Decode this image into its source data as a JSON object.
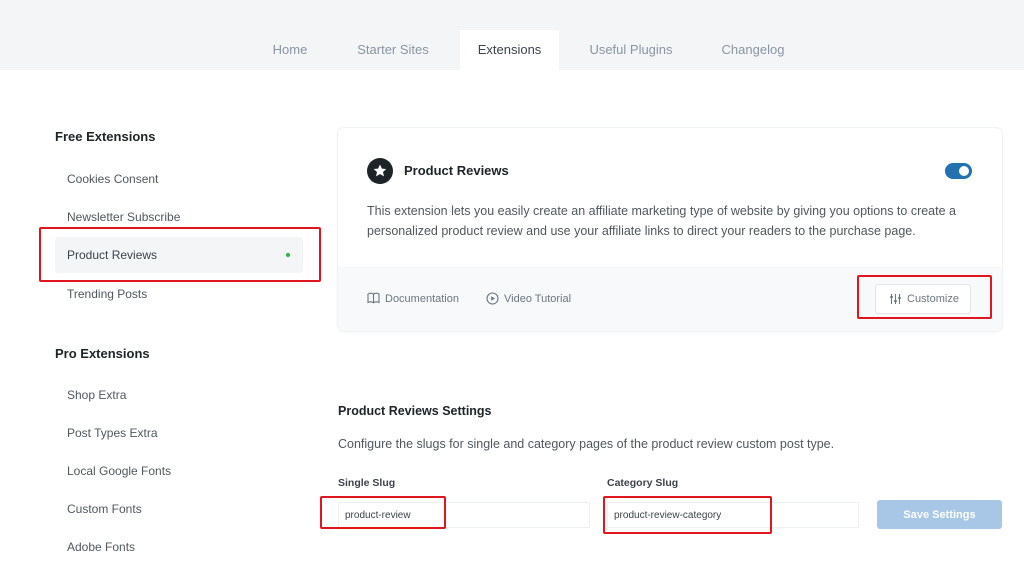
{
  "tabs": [
    {
      "label": "Home",
      "active": false
    },
    {
      "label": "Starter Sites",
      "active": false
    },
    {
      "label": "Extensions",
      "active": true
    },
    {
      "label": "Useful Plugins",
      "active": false
    },
    {
      "label": "Changelog",
      "active": false
    }
  ],
  "sidebar": {
    "free_heading": "Free Extensions",
    "free_items": [
      "Cookies Consent",
      "Newsletter Subscribe",
      "Product Reviews",
      "Trending Posts"
    ],
    "pro_heading": "Pro Extensions",
    "pro_items": [
      "Shop Extra",
      "Post Types Extra",
      "Local Google Fonts",
      "Custom Fonts",
      "Adobe Fonts"
    ],
    "active_item": "Product Reviews"
  },
  "card": {
    "icon": "star-icon",
    "title": "Product Reviews",
    "enabled": true,
    "description": "This extension lets you easily create an affiliate marketing type of website by giving you options to create a personalized product review and use your affiliate links to direct your readers to the purchase page.",
    "documentation_label": "Documentation",
    "documentation_icon": "book-icon",
    "video_label": "Video Tutorial",
    "video_icon": "play-circle-icon",
    "customize_label": "Customize",
    "customize_icon": "sliders-icon"
  },
  "settings": {
    "title": "Product Reviews Settings",
    "description": "Configure the slugs for single and category pages of the product review custom post type.",
    "single_slug_label": "Single Slug",
    "single_slug_value": "product-review",
    "category_slug_label": "Category Slug",
    "category_slug_value": "product-review-category",
    "save_label": "Save Settings"
  },
  "colors": {
    "accent": "#2271b1",
    "highlight": "#e0161e",
    "active_dot": "#2fb344",
    "save_button": "#a8c7e6"
  }
}
